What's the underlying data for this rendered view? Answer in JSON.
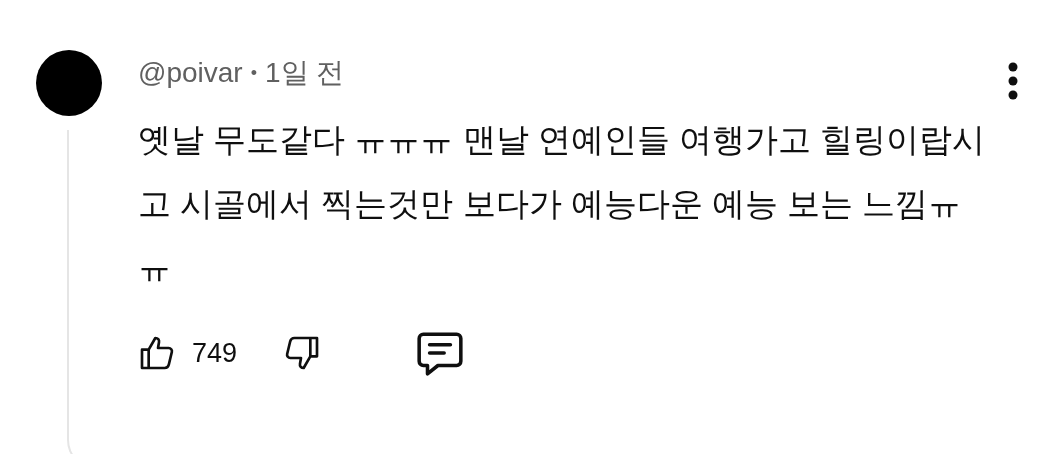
{
  "comment": {
    "author": "@poivar",
    "separator": "•",
    "time": "1일 전",
    "text": "옛날 무도같다 ㅠㅠㅠ 맨날 연예인들 여행가고 힐링이랍시고 시골에서 찍는것만 보다가 예능다운 예능 보는 느낌ㅠㅠ",
    "likes": "749"
  }
}
